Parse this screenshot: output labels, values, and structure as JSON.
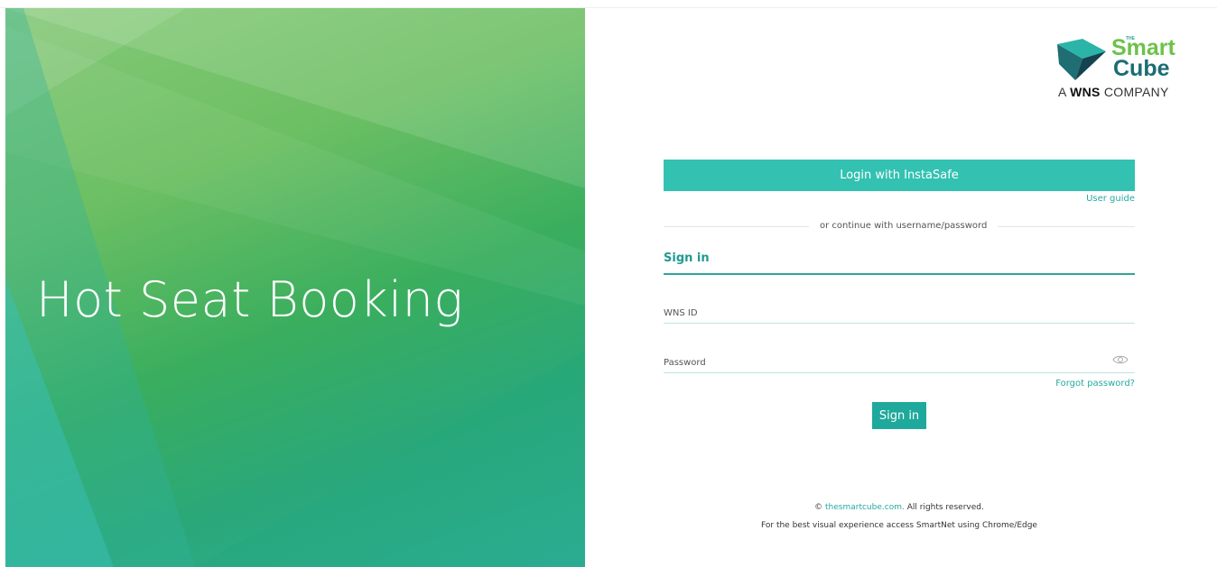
{
  "hero": {
    "title": "Hot Seat Booking"
  },
  "logo": {
    "the": "THE",
    "smart": "Smart",
    "cube": "Cube",
    "company_prefix": "A",
    "company_brand": "WNS",
    "company_suffix": "COMPANY"
  },
  "login": {
    "instasafe_label": "Login with InstaSafe",
    "user_guide": "User guide",
    "divider_text": "or continue with username/password",
    "signin_tab": "Sign in",
    "username_placeholder": "WNS ID",
    "password_placeholder": "Password",
    "forgot_password": "Forgot password?",
    "signin_button": "Sign in"
  },
  "footer": {
    "copyright_symbol": "©",
    "site_link": "thesmartcube.com.",
    "rights": "All rights reserved.",
    "best_experience": "For the best visual experience access SmartNet using Chrome/Edge"
  },
  "colors": {
    "accent": "#33c1b1",
    "link": "#27a9a0",
    "hero_green": "#6cbf63"
  },
  "icons": [
    "eye-icon",
    "smartcube-logo-icon"
  ]
}
